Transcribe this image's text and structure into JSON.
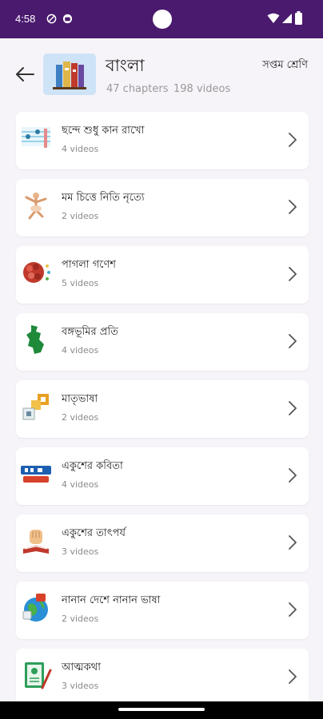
{
  "status_bar": {
    "time": "4:58",
    "icons": [
      "shield-icon",
      "notification-icon",
      "wifi-icon",
      "signal-icon",
      "battery-icon"
    ]
  },
  "header": {
    "title": "বাংলা",
    "chapters_text": "47 chapters",
    "videos_text": "198 videos",
    "class_label": "সপ্তম শ্রেণি",
    "back_icon": "back-arrow-icon",
    "thumbnail_icon": "books-icon"
  },
  "chapters": [
    {
      "title": "ছন্দে শুধু কান রাখো",
      "subtitle": "4 videos",
      "icon": "music-notes-icon"
    },
    {
      "title": "মম চিত্তে নিতি নৃত্যে",
      "subtitle": "2 videos",
      "icon": "dancer-icon"
    },
    {
      "title": "পাগলা গণেশ",
      "subtitle": "5 videos",
      "icon": "brain-icon"
    },
    {
      "title": "বঙ্গভূমির প্রতি",
      "subtitle": "4 videos",
      "icon": "bengal-map-icon"
    },
    {
      "title": "মাতৃভাষা",
      "subtitle": "2 videos",
      "icon": "alphabet-blocks-icon"
    },
    {
      "title": "একুশের কবিতা",
      "subtitle": "4 videos",
      "icon": "ekushe-icon"
    },
    {
      "title": "একুশের তাৎপর্য",
      "subtitle": "3 videos",
      "icon": "fist-book-icon"
    },
    {
      "title": "নানান দেশে নানান ভাষা",
      "subtitle": "2 videos",
      "icon": "globe-languages-icon"
    },
    {
      "title": "আত্মকথা",
      "subtitle": "3 videos",
      "icon": "notebook-pen-icon"
    }
  ],
  "colors": {
    "status_bar": "#4a1a6e",
    "background": "#f6f4f9",
    "thumbnail_bg": "#cfe3f7"
  }
}
